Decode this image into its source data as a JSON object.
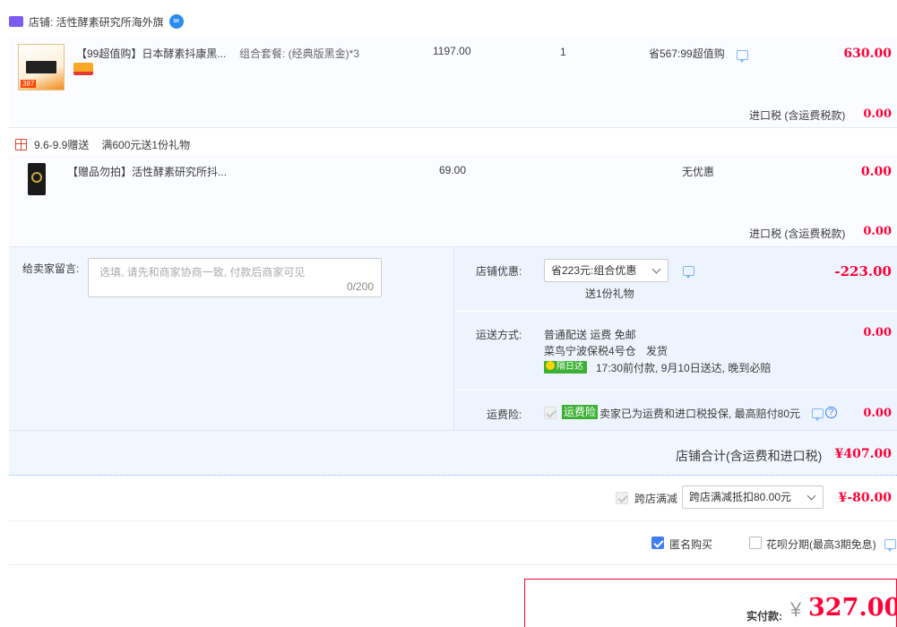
{
  "shop": {
    "name": "店铺: 活性酵素研究所海外旗",
    "tmall_badge": "tmall-global-icon",
    "chat_badge": "chat-bubble-icon"
  },
  "item1": {
    "title": "【99超值购】日本酵素抖康黑...",
    "spec": "组合套餐: (经典版黑金)*3",
    "price": "1197.00",
    "qty": "1",
    "discount": "省567:99超值购",
    "total": "630.00",
    "thumb_tag": "387"
  },
  "tax1": {
    "label": "进口税 (含运费税款)",
    "value": "0.00"
  },
  "gift": {
    "promo": "9.6-9.9赠送",
    "rule": "满600元送1份礼物",
    "title": "【赠品勿拍】活性酵素研究所抖...",
    "price": "69.00",
    "discount": "无优惠",
    "total": "0.00"
  },
  "tax2": {
    "label": "进口税 (含运费税款)",
    "value": "0.00"
  },
  "message": {
    "label": "给卖家留言:",
    "placeholder": "选填, 请先和商家协商一致, 付款后商家可见",
    "counter": "0/200"
  },
  "shop_discount": {
    "label": "店铺优惠:",
    "selected": "省223元:组合优惠",
    "note": "送1份礼物",
    "value": "-223.00"
  },
  "shipping": {
    "label": "运送方式:",
    "line1": "普通配送 运费 免邮",
    "line2": "菜鸟宁波保税4号仓",
    "line2b": "发货",
    "badge": "隔日达",
    "line3": "17:30前付款, 9月10日送达, 晚到必赔",
    "value": "0.00"
  },
  "insurance": {
    "label": "运费险:",
    "tag": "运费险",
    "text": "卖家已为运费和进口税投保, 最高赔付80元",
    "value": "0.00"
  },
  "shop_total": {
    "label": "店铺合计(含运费和进口税)",
    "value": "¥407.00"
  },
  "cross": {
    "label": "跨店满减",
    "selected": "跨店满减抵扣80.00元",
    "value": "¥-80.00"
  },
  "options": {
    "anonymous": "匿名购买",
    "huabei": "花呗分期(最高3期免息)"
  },
  "pay": {
    "label": "实付款:",
    "currency": "¥",
    "value": "327.00"
  },
  "colors": {
    "accent": "#ff0036",
    "blue": "#3d7ef5",
    "green": "#3cb034"
  }
}
